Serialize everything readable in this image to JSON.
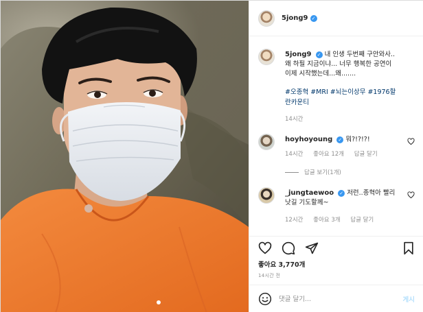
{
  "post": {
    "username": "5jong9",
    "verified_icon": "verified-badge-icon",
    "photo_description_icon": "selfie-photo"
  },
  "caption": {
    "username": "5jong9",
    "line1": "내 인생 두번째 구안와사..",
    "line2": "왜 하필 지금이냐... 너무 행복한 공연이",
    "line3": "이제 시작했는데...왜.......",
    "hashtags_line1": "#오종혁 #MRI #뇌는이상무 #1976할",
    "hashtags_line2": "란카운티",
    "time": "14시간"
  },
  "comments": [
    {
      "username": "hoyhoyoung",
      "text": "뭐?!?!?!",
      "time": "14시간",
      "likes": "좋아요 12개",
      "reply": "답글 달기",
      "view_replies": "답글 보기(1개)"
    },
    {
      "username": "_jungtaewoo",
      "text_line1": "저런..종혁아 빨리",
      "text_line2": "낫길 기도할께~",
      "time": "12시간",
      "likes": "좋아요 3개",
      "reply": "답글 달기"
    }
  ],
  "actions": {
    "likes_text": "좋아요 3,770개",
    "timestamp": "14시간 전"
  },
  "comment_box": {
    "placeholder": "댓글 달기...",
    "post_label": "게시"
  },
  "colors": {
    "link": "#00376b",
    "verified": "#3897f0",
    "muted": "#8e8e8e",
    "post_button": "#b2dffc",
    "scrub_orange": "#f07a32"
  }
}
